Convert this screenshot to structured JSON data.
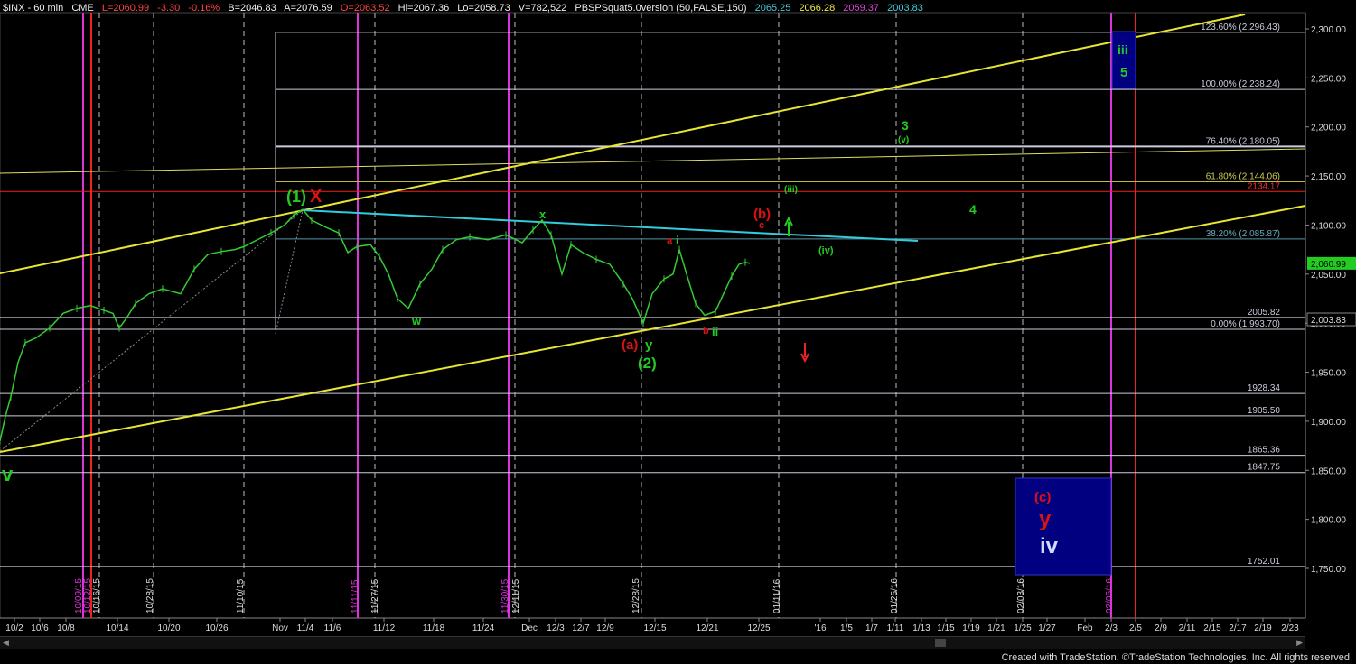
{
  "header": {
    "symbol": "$INX - 60 min",
    "exchange": "CME",
    "last": "L=2060.99",
    "chg": "-3.30",
    "pct": "-0.16%",
    "bid": "B=2046.83",
    "ask": "A=2076.59",
    "open": "O=2063.52",
    "hi": "Hi=2067.36",
    "lo": "Lo=2058.73",
    "vol": "V=782,522",
    "study": "PBSPSquat5.0version (50,FALSE,150)",
    "v1": "2065.25",
    "v2": "2066.28",
    "v3": "2059.37",
    "v4": "2003.83"
  },
  "credit": "Created with TradeStation. ©TradeStation Technologies, Inc. All rights reserved.",
  "colors": {
    "background": "#000000",
    "price_bars": "#33cc33",
    "channel": "#e6e633",
    "trendline": "#33ccdd",
    "wave_green": "#22cc22",
    "wave_red": "#dd1111",
    "magenta_lines": "#dd33dd",
    "target_box": "#000080",
    "last_price_bg": "#22cc22"
  },
  "chart_data": {
    "type": "line",
    "title": "",
    "ylim": [
      1700,
      2320
    ],
    "y_ticks": [
      "2,300.00",
      "2,250.00",
      "2,200.00",
      "2,150.00",
      "2,100.00",
      "2,050.00",
      "2,000.00",
      "1,950.00",
      "1,900.00",
      "1,850.00",
      "1,800.00",
      "1,750.00"
    ],
    "x_ticks": [
      "10/2",
      "10/6",
      "10/8",
      "10/14",
      "10/20",
      "10/26",
      "Nov",
      "11/4",
      "11/6",
      "11/12",
      "11/18",
      "11/24",
      "Dec",
      "12/3",
      "12/7",
      "12/9",
      "12/15",
      "12/21",
      "12/25",
      "'16",
      "1/5",
      "1/7",
      "1/11",
      "1/13",
      "1/15",
      "1/19",
      "1/21",
      "1/25",
      "1/27",
      "Feb",
      "2/3",
      "2/5",
      "2/9",
      "2/11",
      "2/15",
      "2/17",
      "2/19",
      "2/23"
    ],
    "date_markers": [
      "10/09/15",
      "10/12/15",
      "10/16/15",
      "10/28/15",
      "11/10/15",
      "11/11/15",
      "11/27/15",
      "11/30/15",
      "12/11/15",
      "12/28/15",
      "01/11/16",
      "01/25/16",
      "02/03/16",
      "02/05/16"
    ],
    "price_series": {
      "name": "$INX",
      "points": [
        [
          0,
          1880
        ],
        [
          6,
          1905
        ],
        [
          12,
          1925
        ],
        [
          20,
          1960
        ],
        [
          28,
          1980
        ],
        [
          40,
          1985
        ],
        [
          55,
          1995
        ],
        [
          70,
          2010
        ],
        [
          85,
          2015
        ],
        [
          100,
          2018
        ],
        [
          115,
          2013
        ],
        [
          125,
          2010
        ],
        [
          132,
          1995
        ],
        [
          140,
          2005
        ],
        [
          150,
          2020
        ],
        [
          165,
          2030
        ],
        [
          180,
          2035
        ],
        [
          200,
          2030
        ],
        [
          215,
          2055
        ],
        [
          230,
          2070
        ],
        [
          245,
          2073
        ],
        [
          260,
          2075
        ],
        [
          270,
          2078
        ],
        [
          285,
          2085
        ],
        [
          300,
          2092
        ],
        [
          315,
          2100
        ],
        [
          325,
          2110
        ],
        [
          335,
          2116
        ],
        [
          345,
          2105
        ],
        [
          360,
          2098
        ],
        [
          375,
          2092
        ],
        [
          385,
          2072
        ],
        [
          395,
          2078
        ],
        [
          410,
          2080
        ],
        [
          420,
          2068
        ],
        [
          430,
          2050
        ],
        [
          440,
          2025
        ],
        [
          452,
          2015
        ],
        [
          465,
          2040
        ],
        [
          478,
          2055
        ],
        [
          490,
          2075
        ],
        [
          505,
          2085
        ],
        [
          520,
          2088
        ],
        [
          540,
          2085
        ],
        [
          560,
          2090
        ],
        [
          578,
          2082
        ],
        [
          590,
          2095
        ],
        [
          600,
          2105
        ],
        [
          610,
          2090
        ],
        [
          622,
          2050
        ],
        [
          632,
          2080
        ],
        [
          645,
          2072
        ],
        [
          660,
          2065
        ],
        [
          675,
          2060
        ],
        [
          690,
          2040
        ],
        [
          700,
          2025
        ],
        [
          712,
          2000
        ],
        [
          722,
          2030
        ],
        [
          735,
          2045
        ],
        [
          745,
          2050
        ],
        [
          752,
          2075
        ],
        [
          760,
          2050
        ],
        [
          770,
          2020
        ],
        [
          780,
          2008
        ],
        [
          792,
          2012
        ],
        [
          800,
          2028
        ],
        [
          810,
          2048
        ],
        [
          818,
          2060
        ],
        [
          825,
          2062
        ],
        [
          830,
          2061
        ]
      ]
    },
    "horizontal_levels": [
      {
        "label": "123.60% (2,296.43)",
        "value": 2296.43
      },
      {
        "label": "100.00% (2,238.24)",
        "value": 2238.24
      },
      {
        "label": "76.40% (2,180.05)",
        "value": 2180.05
      },
      {
        "label": "61.80% (2,144.06)",
        "value": 2144.06
      },
      {
        "label": "2134.17",
        "value": 2134.17
      },
      {
        "label": "38.20% (2,085.87)",
        "value": 2085.87
      },
      {
        "label": "2005.82",
        "value": 2005.82
      },
      {
        "label": "0.00% (1,993.70)",
        "value": 1993.7
      },
      {
        "label": "1928.34",
        "value": 1928.34
      },
      {
        "label": "1905.50",
        "value": 1905.5
      },
      {
        "label": "1865.36",
        "value": 1865.36
      },
      {
        "label": "1847.75",
        "value": 1847.75
      },
      {
        "label": "1752.01",
        "value": 1752.01
      }
    ],
    "last_price": "2,060.99",
    "price_tag": "2,003.83",
    "wave_labels": [
      {
        "text": "(1)",
        "color": "green"
      },
      {
        "text": "X",
        "color": "red"
      },
      {
        "text": "x",
        "color": "green"
      },
      {
        "text": "w",
        "color": "green"
      },
      {
        "text": "(a)",
        "color": "red"
      },
      {
        "text": "y",
        "color": "green"
      },
      {
        "text": "(2)",
        "color": "green"
      },
      {
        "text": "a",
        "color": "red"
      },
      {
        "text": "i",
        "color": "green"
      },
      {
        "text": "b",
        "color": "red"
      },
      {
        "text": "ii",
        "color": "green"
      },
      {
        "text": "(b)",
        "color": "red"
      },
      {
        "text": "c",
        "color": "red"
      },
      {
        "text": "(iii)",
        "color": "green"
      },
      {
        "text": "(iv)",
        "color": "green"
      },
      {
        "text": "3",
        "color": "green"
      },
      {
        "text": "(v)",
        "color": "green"
      },
      {
        "text": "4",
        "color": "green"
      },
      {
        "text": "iii",
        "color": "green"
      },
      {
        "text": "5",
        "color": "green"
      },
      {
        "text": "v",
        "color": "green"
      },
      {
        "text": "(c)",
        "color": "red"
      },
      {
        "text": "y",
        "color": "red"
      },
      {
        "text": "iv",
        "color": "white"
      }
    ]
  }
}
